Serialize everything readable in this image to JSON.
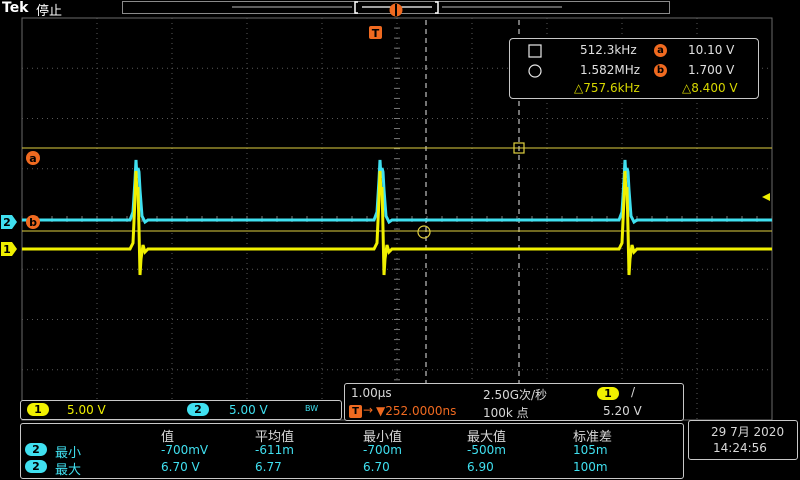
{
  "header": {
    "logo": "Tek",
    "state": "停止"
  },
  "trigger_marker": "T",
  "cursor_readout": {
    "square_freq": "512.3kHz",
    "circle_freq": "1.582MHz",
    "delta_freq": "△757.6kHz",
    "cursor_a_label": "a",
    "cursor_a_value": "10.10 V",
    "cursor_b_label": "b",
    "cursor_b_value": "1.700 V",
    "delta_value": "△8.400 V"
  },
  "left_markers": {
    "cursor_a": "a",
    "cursor_b": "b",
    "ch2": "2",
    "ch1": "1"
  },
  "channels": {
    "ch1_num": "1",
    "ch1_scale": "5.00 V",
    "ch2_num": "2",
    "ch2_scale": "5.00 V",
    "bw_flag": "BW"
  },
  "timebase": {
    "scale": "1.00µs",
    "sample_rate": "2.50G次/秒",
    "trigger_channel": "1",
    "trigger_slope": "/",
    "trigger_position": "▼252.0000ns",
    "record_length": "100k 点",
    "trigger_level": "5.20 V"
  },
  "measurements": {
    "headers": [
      "值",
      "平均值",
      "最小值",
      "最大值",
      "标准差"
    ],
    "rows": [
      {
        "channel": "2",
        "name": "最小",
        "values": [
          "-700mV",
          "-611m",
          "-700m",
          "-500m",
          "105m"
        ]
      },
      {
        "channel": "2",
        "name": "最大",
        "values": [
          "6.70 V",
          "6.77",
          "6.70",
          "6.90",
          "100m"
        ]
      }
    ]
  },
  "datetime": {
    "date": "29 7月 2020",
    "time": "14:24:56"
  },
  "colors": {
    "ch1": "#f0f000",
    "ch2": "#40e0f0",
    "cursor": "#f06a20",
    "grid": "#5a5a5a"
  }
}
